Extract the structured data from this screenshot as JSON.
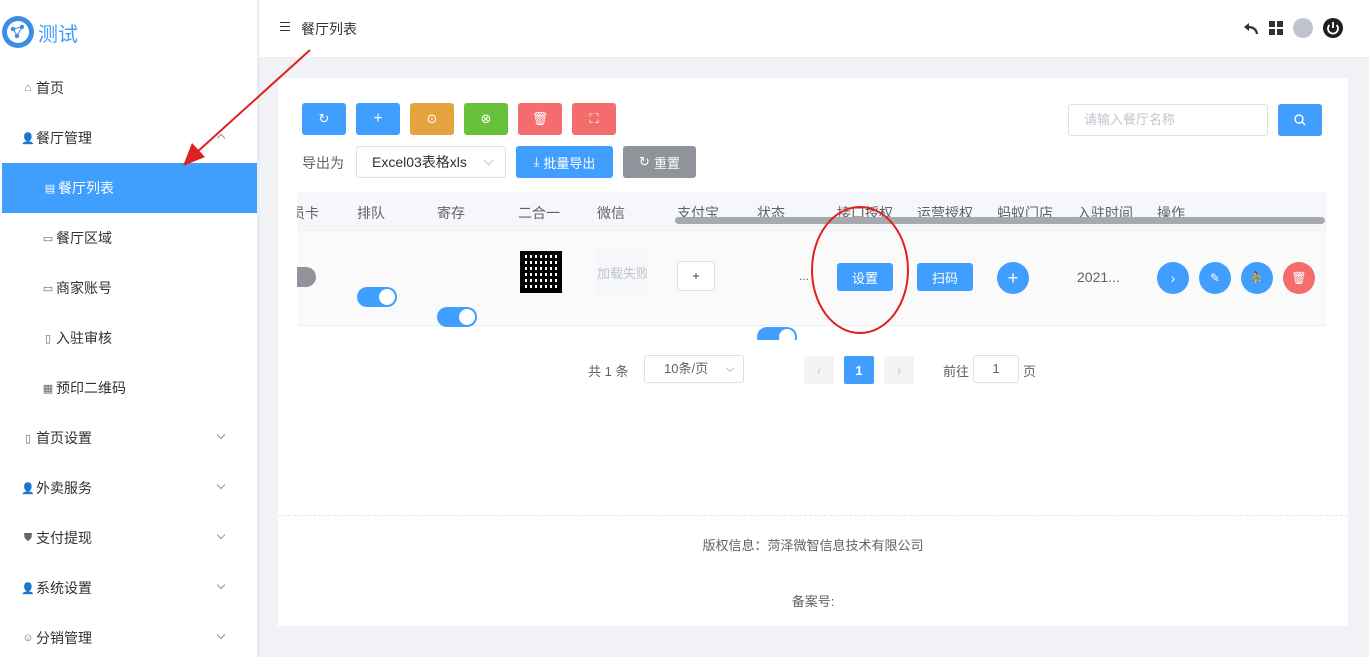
{
  "app": {
    "title": "测试"
  },
  "sidebar": {
    "items": [
      {
        "label": "首页"
      },
      {
        "label": "餐厅管理"
      },
      {
        "label": "餐厅列表"
      },
      {
        "label": "餐厅区域"
      },
      {
        "label": "商家账号"
      },
      {
        "label": "入驻审核"
      },
      {
        "label": "预印二维码"
      },
      {
        "label": "首页设置"
      },
      {
        "label": "外卖服务"
      },
      {
        "label": "支付提现"
      },
      {
        "label": "系统设置"
      },
      {
        "label": "分销管理"
      }
    ]
  },
  "header": {
    "breadcrumb": "餐厅列表"
  },
  "toolbar": {
    "export_label": "导出为",
    "export_format": "Excel03表格xls",
    "batch_export": "批量导出",
    "reset": "重置",
    "search_placeholder": "请输入餐厅名称"
  },
  "table": {
    "columns": [
      "会员卡",
      "排队",
      "寄存",
      "二合一",
      "微信",
      "支付宝",
      "状态",
      "接口授权",
      "运营授权",
      "蚂蚁门店",
      "入驻时间",
      "操作"
    ],
    "row": {
      "wechat": "加载失败",
      "alipay_btn": "+",
      "status_more": "...",
      "api_btn": "设置",
      "ops_btn": "扫码",
      "time": "2021..."
    }
  },
  "pagination": {
    "total": "共 1 条",
    "page_size": "10条/页",
    "current": "1",
    "goto": "前往",
    "goto_value": "1",
    "page_unit": "页"
  },
  "footer": {
    "copyright": "版权信息：菏泽微智信息技术有限公司",
    "icp": "备案号:"
  },
  "colors": {
    "primary": "#409eff",
    "warning": "#e6a23c",
    "success": "#67c23a",
    "danger": "#f56c6c",
    "info": "#909399",
    "annotation": "#e02020"
  }
}
